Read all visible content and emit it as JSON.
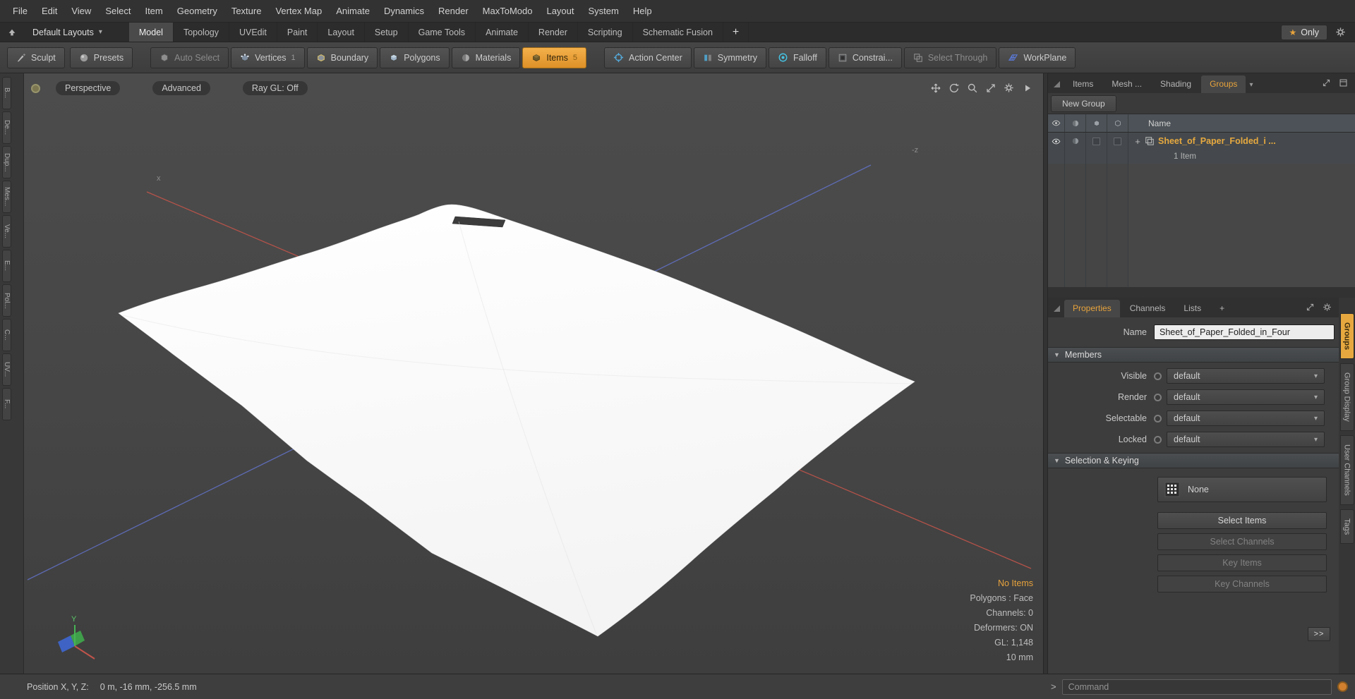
{
  "colors": {
    "accent": "#e7a33c"
  },
  "menubar": {
    "items": [
      "File",
      "Edit",
      "View",
      "Select",
      "Item",
      "Geometry",
      "Texture",
      "Vertex Map",
      "Animate",
      "Dynamics",
      "Render",
      "MaxToModo",
      "Layout",
      "System",
      "Help"
    ]
  },
  "layoutbar": {
    "layout_selector": "Default Layouts",
    "tabs": [
      "Model",
      "Topology",
      "UVEdit",
      "Paint",
      "Layout",
      "Setup",
      "Game Tools",
      "Animate",
      "Render",
      "Scripting",
      "Schematic Fusion"
    ],
    "add_tab": "+",
    "only_label": "Only"
  },
  "toolbar": {
    "sculpt": "Sculpt",
    "presets": "Presets",
    "auto_select": "Auto Select",
    "modes": [
      {
        "label": "Vertices",
        "badge": "1"
      },
      {
        "label": "Boundary",
        "badge": ""
      },
      {
        "label": "Polygons",
        "badge": ""
      },
      {
        "label": "Materials",
        "badge": ""
      },
      {
        "label": "Items",
        "badge": "5"
      }
    ],
    "action_center": "Action Center",
    "symmetry": "Symmetry",
    "falloff": "Falloff",
    "constraints": "Constrai...",
    "select_through": "Select Through",
    "workplane": "WorkPlane"
  },
  "left_tabs": [
    "B...",
    "De...",
    "Dup...",
    "Mes...",
    "Ve...",
    "E...",
    "Pol...",
    "C...",
    "UV...",
    "F..."
  ],
  "viewport": {
    "buttons": [
      "Perspective",
      "Advanced",
      "Ray GL: Off"
    ],
    "axis_labels": {
      "x": "x",
      "z": "-z"
    },
    "gizmo_y": "Y",
    "info": {
      "no_items": "No Items",
      "lines": [
        "Polygons : Face",
        "Channels: 0",
        "Deformers: ON",
        "GL: 1,148",
        "10 mm"
      ]
    }
  },
  "right_panel": {
    "list_tabs": [
      "Items",
      "Mesh ...",
      "Shading",
      "Groups"
    ],
    "new_group": "New Group",
    "name_column": "Name",
    "group_row": {
      "label": "Sheet_of_Paper_Folded_i ...",
      "count": "1 Item"
    },
    "prop_tabs": [
      "Properties",
      "Channels",
      "Lists",
      "+"
    ],
    "name_label": "Name",
    "name_value": "Sheet_of_Paper_Folded_in_Four",
    "sections": {
      "members": "Members",
      "selection_keying": "Selection & Keying"
    },
    "member_rows": [
      {
        "label": "Visible",
        "value": "default"
      },
      {
        "label": "Render",
        "value": "default"
      },
      {
        "label": "Selectable",
        "value": "default"
      },
      {
        "label": "Locked",
        "value": "default"
      }
    ],
    "none_label": "None",
    "buttons": [
      {
        "label": "Select Items"
      },
      {
        "label": "Select Channels"
      },
      {
        "label": "Key Items"
      },
      {
        "label": "Key Channels"
      }
    ],
    "expand_button": ">>",
    "side_tabs": [
      "Groups",
      "Group Display",
      "User Channels",
      "Tags"
    ]
  },
  "statusbar": {
    "position_label": "Position X, Y, Z:",
    "position_value": "0 m, -16 mm, -256.5 mm",
    "prompt": ">",
    "command_placeholder": "Command"
  }
}
